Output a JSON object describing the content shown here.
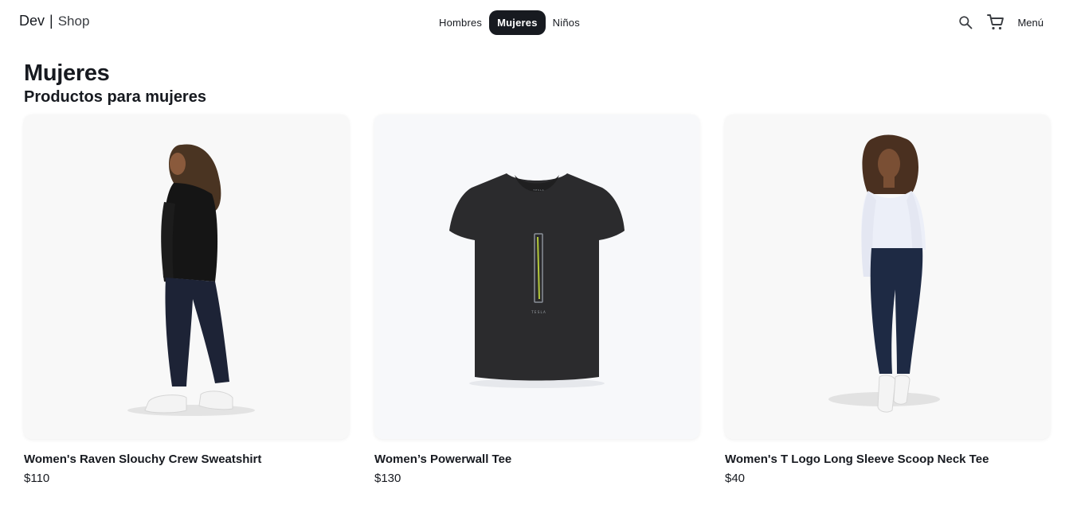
{
  "header": {
    "brand_primary": "Dev",
    "brand_separator": "|",
    "brand_secondary": "Shop",
    "nav": [
      {
        "label": "Hombres",
        "active": false
      },
      {
        "label": "Mujeres",
        "active": true
      },
      {
        "label": "Niños",
        "active": false
      }
    ],
    "menu_label": "Menú",
    "icons": [
      "search-icon",
      "cart-icon"
    ]
  },
  "page": {
    "title": "Mujeres",
    "subtitle": "Productos para mujeres"
  },
  "products": [
    {
      "name": "Women's Raven Slouchy Crew Sweatshirt",
      "price": "$110",
      "image": "woman-in-black-sweatshirt-photo"
    },
    {
      "name": "Women’s Powerwall Tee",
      "price": "$130",
      "image": "black-v-neck-tee-photo"
    },
    {
      "name": "Women's T Logo Long Sleeve Scoop Neck Tee",
      "price": "$40",
      "image": "woman-in-white-long-sleeve-tee-photo"
    }
  ],
  "colors": {
    "text": "#171a20",
    "active_pill": "#171a20",
    "card_bg": "#f8f8f8"
  }
}
